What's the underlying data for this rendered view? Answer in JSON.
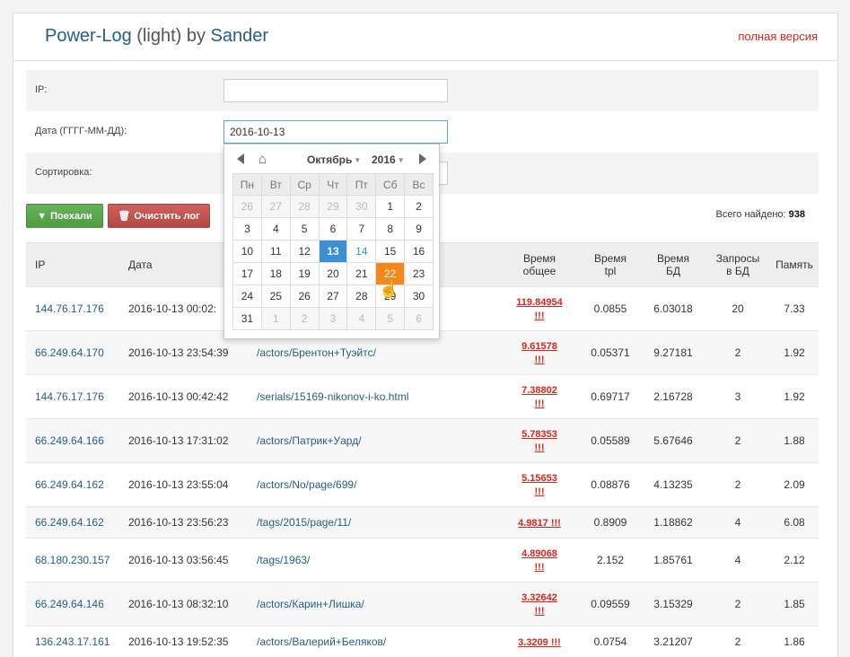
{
  "header": {
    "brand_part1": "Power-Log",
    "brand_part2": " (light) by ",
    "brand_part3": "Sander",
    "full_version": "полная версия"
  },
  "form": {
    "ip_label": "IP:",
    "ip_value": "",
    "date_label": "Дата (ГГГГ-ММ-ДД):",
    "date_value": "2016-10-13",
    "sort_label": "Сортировка:",
    "go_button": "Поехали",
    "clear_button": "Очистить лог",
    "total_label": "Всего найдено:",
    "total_count": "938"
  },
  "datepicker": {
    "month": "Октябрь",
    "year": "2016",
    "weekdays": [
      "Пн",
      "Вт",
      "Ср",
      "Чт",
      "Пт",
      "Сб",
      "Вс"
    ],
    "weeks": [
      [
        "26",
        "27",
        "28",
        "29",
        "30",
        "1",
        "2"
      ],
      [
        "3",
        "4",
        "5",
        "6",
        "7",
        "8",
        "9"
      ],
      [
        "10",
        "11",
        "12",
        "13",
        "14",
        "15",
        "16"
      ],
      [
        "17",
        "18",
        "19",
        "20",
        "21",
        "22",
        "23"
      ],
      [
        "24",
        "25",
        "26",
        "27",
        "28",
        "29",
        "30"
      ],
      [
        "31",
        "1",
        "2",
        "3",
        "4",
        "5",
        "6"
      ]
    ]
  },
  "table": {
    "headers": {
      "ip": "IP",
      "date": "Дата",
      "total_time_1": "Время",
      "total_time_2": "общее",
      "tpl_1": "Время",
      "tpl_2": "tpl",
      "db_1": "Время",
      "db_2": "БД",
      "queries_1": "Запросы",
      "queries_2": "в БД",
      "memory": "Память"
    },
    "rows": [
      {
        "ip": "144.76.17.176",
        "date": "2016-10-13 00:02:",
        "url": "",
        "time1": "119.84954",
        "time2": "!!!",
        "tpl": "0.0855",
        "db": "6.03018",
        "q": "20",
        "mem": "7.33"
      },
      {
        "ip": "66.249.64.170",
        "date": "2016-10-13 23:54:39",
        "url": "/actors/Брентон+Туэйтс/",
        "time1": "9.61578",
        "time2": "!!!",
        "tpl": "0.05371",
        "db": "9.27181",
        "q": "2",
        "mem": "1.92"
      },
      {
        "ip": "144.76.17.176",
        "date": "2016-10-13 00:42:42",
        "url": "/serials/15169-nikonov-i-ko.html",
        "time1": "7.38802",
        "time2": "!!!",
        "tpl": "0.69717",
        "db": "2.16728",
        "q": "3",
        "mem": "1.92"
      },
      {
        "ip": "66.249.64.166",
        "date": "2016-10-13 17:31:02",
        "url": "/actors/Патрик+Уард/",
        "time1": "5.78353",
        "time2": "!!!",
        "tpl": "0.05589",
        "db": "5.67646",
        "q": "2",
        "mem": "1.88"
      },
      {
        "ip": "66.249.64.162",
        "date": "2016-10-13 23:55:04",
        "url": "/actors/No/page/699/",
        "time1": "5.15653",
        "time2": "!!!",
        "tpl": "0.08876",
        "db": "4.13235",
        "q": "2",
        "mem": "2.09"
      },
      {
        "ip": "66.249.64.162",
        "date": "2016-10-13 23:56:23",
        "url": "/tags/2015/page/11/",
        "time1": "4.9817 !!!",
        "time2": "",
        "tpl": "0.8909",
        "db": "1.18862",
        "q": "4",
        "mem": "6.08"
      },
      {
        "ip": "68.180.230.157",
        "date": "2016-10-13 03:56:45",
        "url": "/tags/1963/",
        "time1": "4.89068",
        "time2": "!!!",
        "tpl": "2.152",
        "db": "1.85761",
        "q": "4",
        "mem": "2.12"
      },
      {
        "ip": "66.249.64.146",
        "date": "2016-10-13 08:32:10",
        "url": "/actors/Карин+Лишка/",
        "time1": "3.32642",
        "time2": "!!!",
        "tpl": "0.09559",
        "db": "3.15329",
        "q": "2",
        "mem": "1.85"
      },
      {
        "ip": "136.243.17.161",
        "date": "2016-10-13 19:52:35",
        "url": "/actors/Валерий+Беляков/",
        "time1": "3.3209 !!!",
        "time2": "",
        "tpl": "0.0754",
        "db": "3.21207",
        "q": "2",
        "mem": "1.86"
      }
    ]
  }
}
